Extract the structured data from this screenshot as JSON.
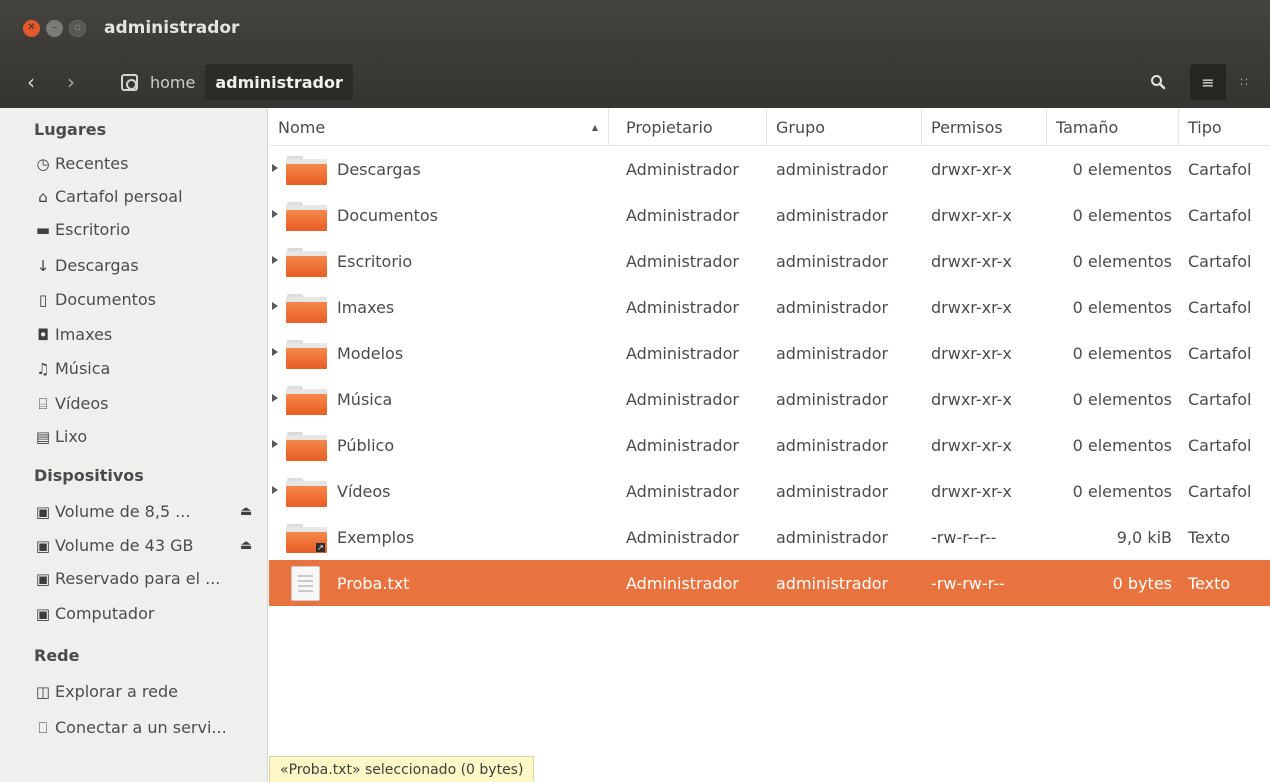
{
  "window": {
    "title": "administrador"
  },
  "toolbar": {
    "breadcrumb_home": "home",
    "breadcrumb_current": "administrador"
  },
  "sidebar": {
    "sections": [
      {
        "heading": "Lugares",
        "items": [
          {
            "label": "Recentes",
            "icon": "clock-icon"
          },
          {
            "label": "Cartafol persoal",
            "icon": "home-icon"
          },
          {
            "label": "Escritorio",
            "icon": "desktop-folder-icon"
          },
          {
            "label": "Descargas",
            "icon": "download-icon"
          },
          {
            "label": "Documentos",
            "icon": "document-icon"
          },
          {
            "label": "Imaxes",
            "icon": "camera-icon"
          },
          {
            "label": "Música",
            "icon": "music-icon"
          },
          {
            "label": "Vídeos",
            "icon": "film-icon"
          },
          {
            "label": "Lixo",
            "icon": "trash-icon"
          }
        ]
      },
      {
        "heading": "Dispositivos",
        "items": [
          {
            "label": "Volume de 8,5 ...",
            "icon": "drive-icon",
            "eject": true
          },
          {
            "label": "Volume de 43 GB",
            "icon": "drive-icon",
            "eject": true
          },
          {
            "label": "Reservado para el ...",
            "icon": "drive-icon"
          },
          {
            "label": "Computador",
            "icon": "drive-icon"
          }
        ]
      },
      {
        "heading": "Rede",
        "items": [
          {
            "label": "Explorar a rede",
            "icon": "network-icon"
          },
          {
            "label": "Conectar a un servi...",
            "icon": "server-icon"
          }
        ]
      }
    ]
  },
  "columns": [
    "Nome",
    "Propietario",
    "Grupo",
    "Permisos",
    "Tamaño",
    "Tipo"
  ],
  "files": [
    {
      "name": "Descargas",
      "owner": "Administrador",
      "group": "administrador",
      "perms": "drwxr-xr-x",
      "size": "0 elementos",
      "type": "Cartafol",
      "kind": "folder"
    },
    {
      "name": "Documentos",
      "owner": "Administrador",
      "group": "administrador",
      "perms": "drwxr-xr-x",
      "size": "0 elementos",
      "type": "Cartafol",
      "kind": "folder"
    },
    {
      "name": "Escritorio",
      "owner": "Administrador",
      "group": "administrador",
      "perms": "drwxr-xr-x",
      "size": "0 elementos",
      "type": "Cartafol",
      "kind": "folder"
    },
    {
      "name": "Imaxes",
      "owner": "Administrador",
      "group": "administrador",
      "perms": "drwxr-xr-x",
      "size": "0 elementos",
      "type": "Cartafol",
      "kind": "folder"
    },
    {
      "name": "Modelos",
      "owner": "Administrador",
      "group": "administrador",
      "perms": "drwxr-xr-x",
      "size": "0 elementos",
      "type": "Cartafol",
      "kind": "folder"
    },
    {
      "name": "Música",
      "owner": "Administrador",
      "group": "administrador",
      "perms": "drwxr-xr-x",
      "size": "0 elementos",
      "type": "Cartafol",
      "kind": "folder"
    },
    {
      "name": "Público",
      "owner": "Administrador",
      "group": "administrador",
      "perms": "drwxr-xr-x",
      "size": "0 elementos",
      "type": "Cartafol",
      "kind": "folder"
    },
    {
      "name": "Vídeos",
      "owner": "Administrador",
      "group": "administrador",
      "perms": "drwxr-xr-x",
      "size": "0 elementos",
      "type": "Cartafol",
      "kind": "folder"
    },
    {
      "name": "Exemplos",
      "owner": "Administrador",
      "group": "administrador",
      "perms": "-rw-r--r--",
      "size": "9,0 kiB",
      "type": "Texto",
      "kind": "link"
    },
    {
      "name": "Proba.txt",
      "owner": "Administrador",
      "group": "administrador",
      "perms": "-rw-rw-r--",
      "size": "0 bytes",
      "type": "Texto",
      "kind": "text",
      "selected": true
    }
  ],
  "statusbar": {
    "text": "«Proba.txt» seleccionado (0 bytes)"
  },
  "colors": {
    "accent": "#e9733f",
    "titlebar": "#3c3b37",
    "sidebar": "#efefee"
  }
}
